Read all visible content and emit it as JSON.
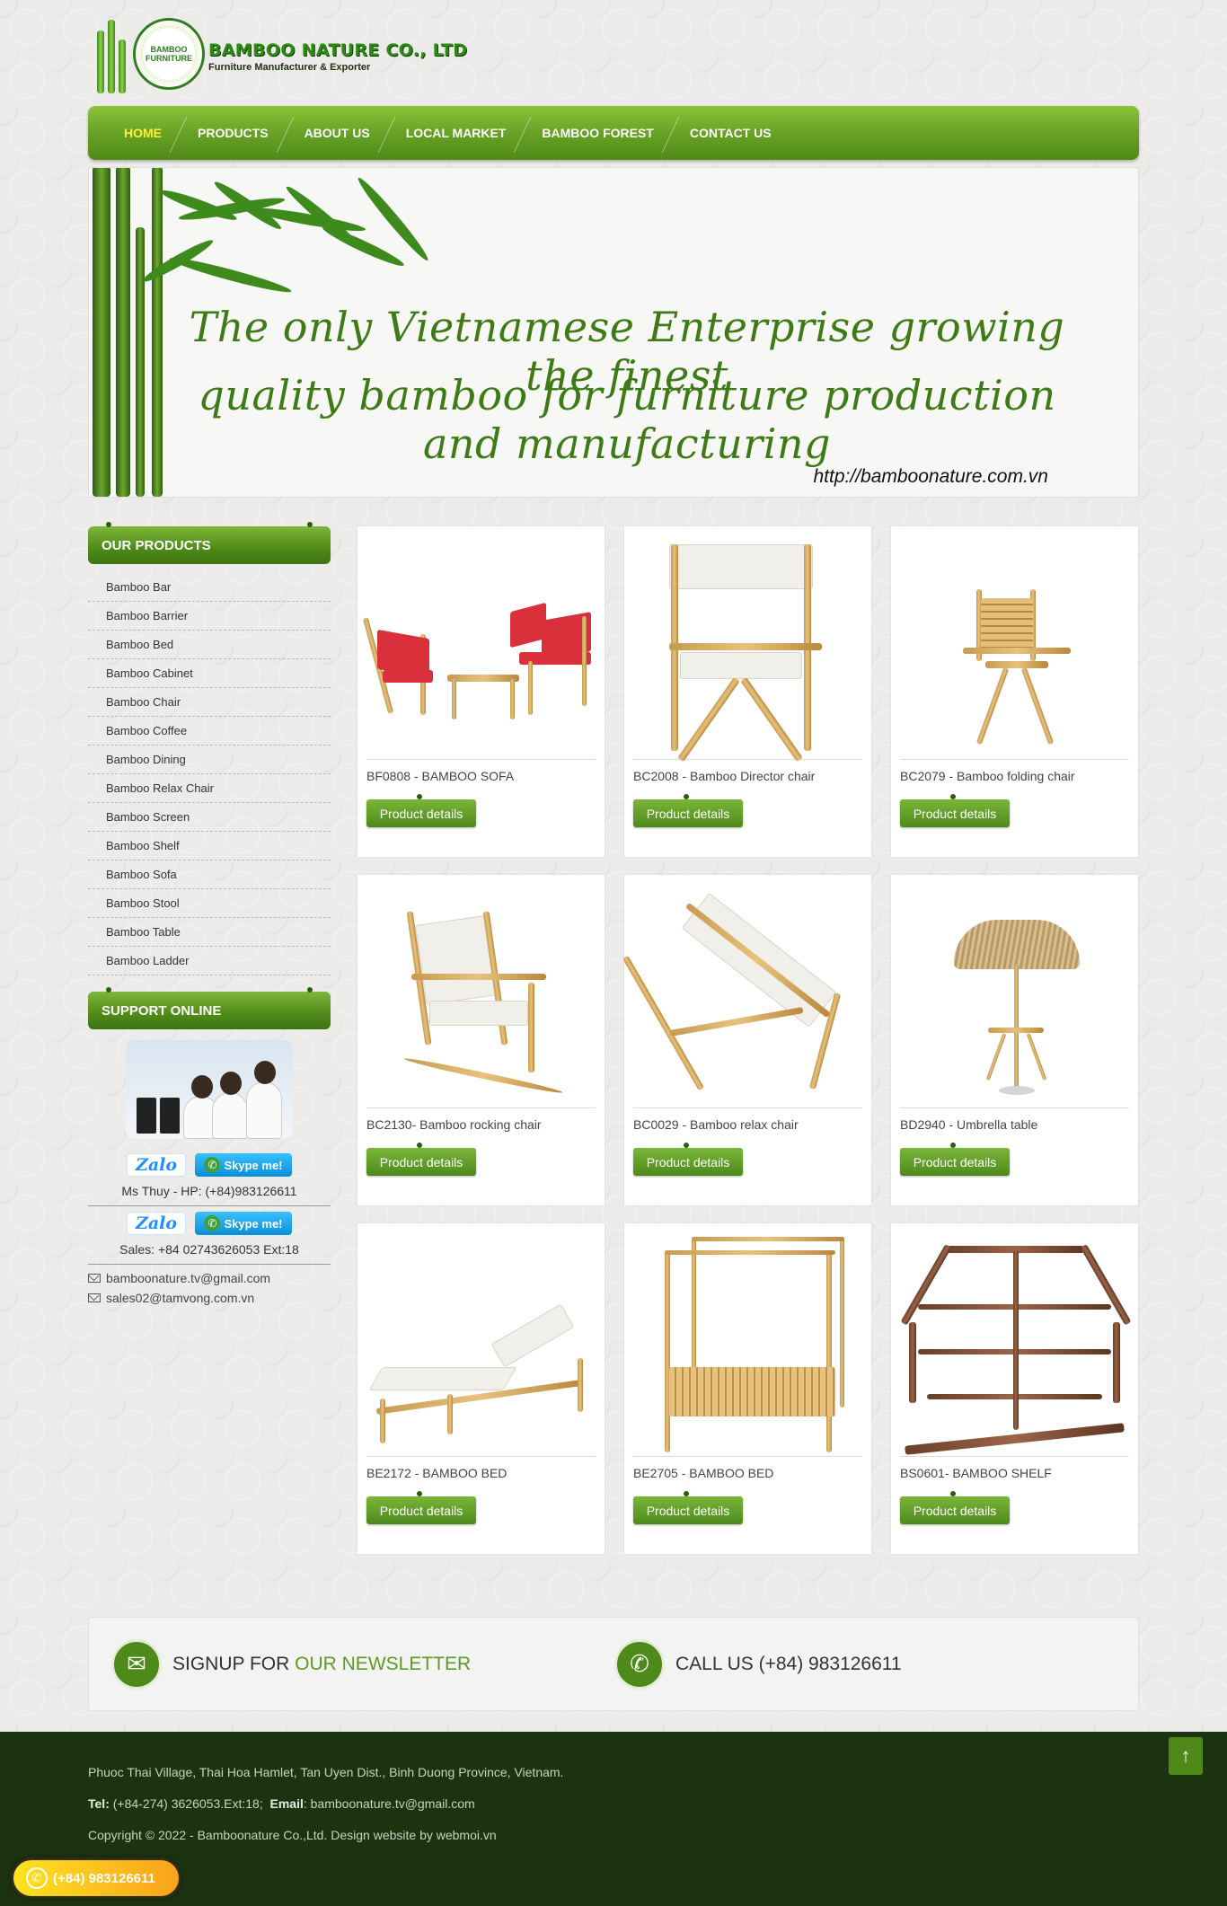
{
  "logo": {
    "circle_text": "BAMBOO FURNITURE",
    "title": "BAMBOO NATURE CO., LTD",
    "subtitle": "Furniture Manufacturer & Exporter"
  },
  "nav": {
    "items": [
      {
        "label": "HOME",
        "active": true
      },
      {
        "label": "PRODUCTS"
      },
      {
        "label": "ABOUT US"
      },
      {
        "label": "LOCAL MARKET"
      },
      {
        "label": "BAMBOO FOREST"
      },
      {
        "label": "CONTACT US"
      }
    ]
  },
  "banner": {
    "line1": "The only Vietnamese Enterprise growing the finest",
    "line2": "quality bamboo for furniture production and manufacturing",
    "url": "http://bamboonature.com.vn"
  },
  "sidebar": {
    "products_heading": "OUR PRODUCTS",
    "products": [
      "Bamboo Bar",
      "Bamboo Barrier",
      "Bamboo Bed",
      "Bamboo Cabinet",
      "Bamboo Chair",
      "Bamboo Coffee",
      "Bamboo Dining",
      "Bamboo Relax Chair",
      "Bamboo Screen",
      "Bamboo Shelf",
      "Bamboo Sofa",
      "Bamboo Stool",
      "Bamboo Table",
      "Bamboo Ladder"
    ],
    "support_heading": "SUPPORT ONLINE",
    "zalo_label": "Zalo",
    "skype_label": "Skype me!",
    "contact1": "Ms Thuy - HP: (+84)983126611",
    "contact2": "Sales: +84 02743626053 Ext:18",
    "email1": "bamboonature.tv@gmail.com",
    "email2": "sales02@tamvong.com.vn"
  },
  "products": {
    "button_label": "Product details",
    "items": [
      {
        "title": "BF0808 - BAMBOO SOFA",
        "icon": "sofa-set-image"
      },
      {
        "title": "BC2008 - Bamboo Director chair",
        "icon": "director-chair-image"
      },
      {
        "title": "BC2079 - Bamboo folding chair",
        "icon": "folding-chair-image"
      },
      {
        "title": "BC2130- Bamboo rocking chair",
        "icon": "rocking-chair-image"
      },
      {
        "title": "BC0029 - Bamboo relax chair",
        "icon": "relax-chair-image"
      },
      {
        "title": "BD2940 - Umbrella table",
        "icon": "umbrella-table-image"
      },
      {
        "title": "BE2172 - BAMBOO BED",
        "icon": "lounger-bed-image"
      },
      {
        "title": "BE2705 - BAMBOO BED",
        "icon": "canopy-bed-image"
      },
      {
        "title": "BS0601- BAMBOO SHELF",
        "icon": "hexagon-shelf-image"
      }
    ]
  },
  "newsletter": {
    "signup_prefix": "SIGNUP FOR ",
    "signup_accent": "OUR NEWSLETTER",
    "call": "CALL US (+84) 983126611"
  },
  "footer": {
    "address": "Phuoc Thai Village, Thai Hoa Hamlet, Tan Uyen Dist., Binh Duong Province, Vietnam.",
    "tel_label": "Tel:",
    "tel_value": "(+84-274) 3626053.Ext:18;",
    "email_label": "Email",
    "email_value": "bamboonature.tv@gmail.com",
    "copyright": "Copyright © 2022 - Bamboonature Co.,Ltd. Design website by webmoi.vn"
  },
  "hotline": "(+84) 983126611",
  "colors": {
    "brand_green": "#4f8a18",
    "nav_active": "#ffef3a",
    "footer_bg": "#1c3310",
    "hotline_yellow": "#ffe321"
  }
}
